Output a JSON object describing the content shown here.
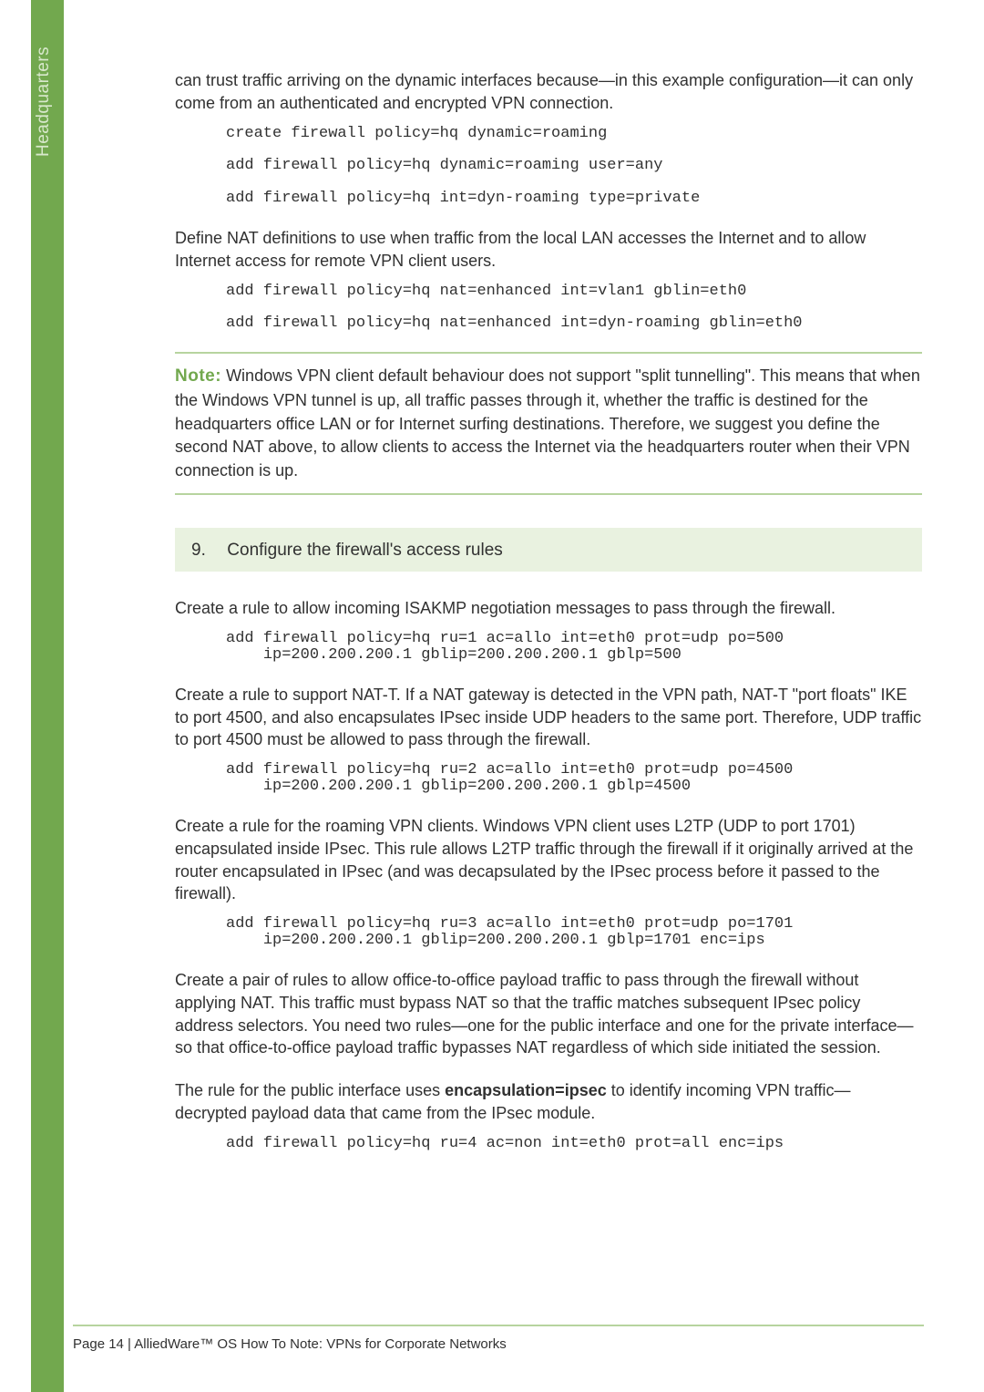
{
  "sidebar": {
    "label": "Headquarters"
  },
  "para1": "can trust traffic arriving on the dynamic interfaces because—in this example configuration—it can only come from an authenticated and encrypted VPN connection.",
  "code1": "create firewall policy=hq dynamic=roaming\n\nadd firewall policy=hq dynamic=roaming user=any\n\nadd firewall policy=hq int=dyn-roaming type=private",
  "para2": "Define NAT definitions to use when traffic from the local LAN accesses the Internet and to allow Internet access for remote VPN client users.",
  "code2": "add firewall policy=hq nat=enhanced int=vlan1 gblin=eth0\n\nadd firewall policy=hq nat=enhanced int=dyn-roaming gblin=eth0",
  "note": {
    "label": "Note:",
    "text": "  Windows VPN client default behaviour does not support \"split tunnelling\". This means that when the Windows VPN tunnel is up, all traffic passes through it, whether the traffic is destined for the headquarters office LAN or for Internet surfing destinations. Therefore, we suggest you define the second NAT above, to allow clients to access the Internet via the headquarters router when their VPN connection is up."
  },
  "step": {
    "num": "9.",
    "title": "Configure the firewall's access rules"
  },
  "para3": "Create a rule to allow incoming ISAKMP negotiation messages to pass through the firewall.",
  "code3": "add firewall policy=hq ru=1 ac=allo int=eth0 prot=udp po=500\n    ip=200.200.200.1 gblip=200.200.200.1 gblp=500",
  "para4": "Create a rule to support NAT-T. If a NAT gateway is detected in the VPN path, NAT-T \"port floats\" IKE to port 4500, and also encapsulates IPsec inside UDP headers to the same port. Therefore, UDP traffic to port 4500 must be allowed to pass through the firewall.",
  "code4": "add firewall policy=hq ru=2 ac=allo int=eth0 prot=udp po=4500\n    ip=200.200.200.1 gblip=200.200.200.1 gblp=4500",
  "para5": "Create a rule for the roaming VPN clients. Windows VPN client uses L2TP (UDP to port 1701) encapsulated inside IPsec. This rule allows L2TP traffic through the firewall if it originally arrived at the router encapsulated in IPsec (and was decapsulated by the IPsec process before it passed to the firewall).",
  "code5": "add firewall policy=hq ru=3 ac=allo int=eth0 prot=udp po=1701\n    ip=200.200.200.1 gblip=200.200.200.1 gblp=1701 enc=ips",
  "para6": "Create a pair of rules to allow office-to-office payload traffic to pass through the firewall without applying NAT. This traffic must bypass NAT so that the traffic matches subsequent IPsec policy address selectors. You need two rules—one for the public interface and one for the private interface—so that office-to-office payload traffic bypasses NAT regardless of which side initiated the session.",
  "para7a": "The rule for the public interface uses ",
  "para7b": "encapsulation=ipsec",
  "para7c": " to identify incoming VPN traffic—decrypted payload data that came from the IPsec module.",
  "code6": "add firewall policy=hq ru=4 ac=non int=eth0 prot=all enc=ips",
  "footer": "Page 14 | AlliedWare™ OS How To Note: VPNs for Corporate Networks"
}
